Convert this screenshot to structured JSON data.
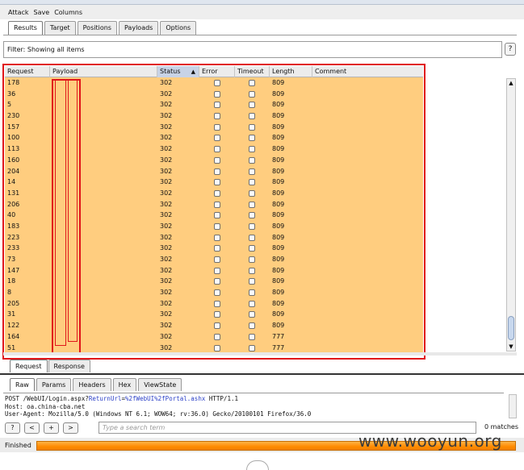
{
  "menu": [
    "Attack",
    "Save",
    "Columns"
  ],
  "top_tabs": [
    {
      "label": "Results",
      "active": true
    },
    {
      "label": "Target",
      "active": false
    },
    {
      "label": "Positions",
      "active": false
    },
    {
      "label": "Payloads",
      "active": false
    },
    {
      "label": "Options",
      "active": false
    }
  ],
  "filter": {
    "text": "Filter: Showing all items",
    "help_label": "?"
  },
  "table": {
    "columns": [
      "Request",
      "Payload",
      "Status",
      "Error",
      "Timeout",
      "Length",
      "Comment"
    ],
    "sorted_column": "Status",
    "rows": [
      {
        "request": "178",
        "payload": "",
        "status": "302",
        "length": "809"
      },
      {
        "request": "36",
        "payload": "",
        "status": "302",
        "length": "809"
      },
      {
        "request": "5",
        "payload": "",
        "status": "302",
        "length": "809"
      },
      {
        "request": "230",
        "payload": "",
        "status": "302",
        "length": "809"
      },
      {
        "request": "157",
        "payload": "",
        "status": "302",
        "length": "809"
      },
      {
        "request": "100",
        "payload": "",
        "status": "302",
        "length": "809"
      },
      {
        "request": "113",
        "payload": "",
        "status": "302",
        "length": "809"
      },
      {
        "request": "160",
        "payload": "",
        "status": "302",
        "length": "809"
      },
      {
        "request": "204",
        "payload": "",
        "status": "302",
        "length": "809"
      },
      {
        "request": "14",
        "payload": "",
        "status": "302",
        "length": "809"
      },
      {
        "request": "131",
        "payload": "",
        "status": "302",
        "length": "809"
      },
      {
        "request": "206",
        "payload": "",
        "status": "302",
        "length": "809"
      },
      {
        "request": "40",
        "payload": "",
        "status": "302",
        "length": "809"
      },
      {
        "request": "183",
        "payload": "",
        "status": "302",
        "length": "809"
      },
      {
        "request": "223",
        "payload": "",
        "status": "302",
        "length": "809"
      },
      {
        "request": "233",
        "payload": "",
        "status": "302",
        "length": "809"
      },
      {
        "request": "73",
        "payload": "",
        "status": "302",
        "length": "809"
      },
      {
        "request": "147",
        "payload": "",
        "status": "302",
        "length": "809"
      },
      {
        "request": "18",
        "payload": "",
        "status": "302",
        "length": "809"
      },
      {
        "request": "8",
        "payload": "",
        "status": "302",
        "length": "809"
      },
      {
        "request": "205",
        "payload": "",
        "status": "302",
        "length": "809"
      },
      {
        "request": "31",
        "payload": "",
        "status": "302",
        "length": "809"
      },
      {
        "request": "122",
        "payload": "",
        "status": "302",
        "length": "809"
      },
      {
        "request": "164",
        "payload": "",
        "status": "302",
        "length": "777"
      },
      {
        "request": "51",
        "payload": "",
        "status": "302",
        "length": "777"
      }
    ]
  },
  "req_tabs": [
    {
      "label": "Request",
      "active": true
    },
    {
      "label": "Response",
      "active": false
    }
  ],
  "sub_tabs": [
    {
      "label": "Raw",
      "active": true
    },
    {
      "label": "Params",
      "active": false
    },
    {
      "label": "Headers",
      "active": false
    },
    {
      "label": "Hex",
      "active": false
    },
    {
      "label": "ViewState",
      "active": false
    }
  ],
  "request_text": {
    "line1_prefix": "POST /WebUI/Login.aspx?",
    "line1_param": "ReturnUrl",
    "line1_eq": "=",
    "line1_value": "%2fWebUI%2fPortal.ashx",
    "line1_suffix": " HTTP/1.1",
    "line2": "Host: oa.china-cba.net",
    "line3": "User-Agent: Mozilla/5.0 (Windows NT 6.1; WOW64; rv:36.0) Gecko/20100101 Firefox/36.0"
  },
  "search": {
    "buttons": [
      "?",
      "<",
      "+",
      ">"
    ],
    "placeholder": "Type a search term",
    "matches": "0 matches"
  },
  "status": {
    "text": "Finished",
    "progress": 1.0
  },
  "watermark": "www.wooyun.org",
  "colors": {
    "row_bg": "#ffcd7f",
    "highlight_border": "#e0161a",
    "progress": "#ff8a00"
  }
}
